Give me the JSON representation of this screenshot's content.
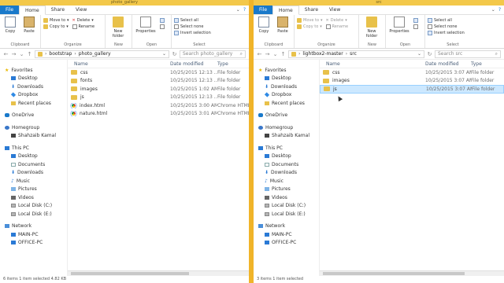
{
  "left": {
    "title": "photo_gallery",
    "tabs": [
      "File",
      "Home",
      "Share",
      "View"
    ],
    "ribbon": {
      "clipboard": {
        "copy": "Copy",
        "paste": "Paste",
        "group": "Clipboard"
      },
      "organize": {
        "move_to": "Move to",
        "copy_to": "Copy to",
        "delete": "Delete",
        "rename": "Rename",
        "group": "Organize"
      },
      "new": {
        "new_folder": "New folder",
        "group": "New"
      },
      "open": {
        "properties": "Properties",
        "group": "Open"
      },
      "select": {
        "select_all": "Select all",
        "select_none": "Select none",
        "invert": "Invert selection",
        "group": "Select"
      }
    },
    "address": [
      "bootstrap",
      "photo_gallery"
    ],
    "search_placeholder": "Search photo_gallery",
    "columns": {
      "name": "Name",
      "date": "Date modified",
      "type": "Type"
    },
    "files": [
      {
        "name": "css",
        "date": "10/25/2015 12:13 ...",
        "type": "File folder",
        "icon": "folder-icon"
      },
      {
        "name": "fonts",
        "date": "10/25/2015 12:13 ...",
        "type": "File folder",
        "icon": "folder-icon"
      },
      {
        "name": "images",
        "date": "10/25/2015 1:02 AM",
        "type": "File folder",
        "icon": "folder-icon"
      },
      {
        "name": "js",
        "date": "10/25/2015 12:13 ...",
        "type": "File folder",
        "icon": "folder-icon"
      },
      {
        "name": "index.html",
        "date": "10/25/2015 3:00 AM",
        "type": "Chrome HTML",
        "icon": "chrome-icon"
      },
      {
        "name": "nature.html",
        "date": "10/25/2015 3:01 AM",
        "type": "Chrome HTML",
        "icon": "chrome-icon"
      }
    ],
    "status": "6 items   1 item selected  4.82 KB"
  },
  "right": {
    "title": "src",
    "tabs": [
      "File",
      "Home",
      "Share",
      "View"
    ],
    "address": [
      "lightbox2-master",
      "src"
    ],
    "search_placeholder": "Search src",
    "columns": {
      "name": "Name",
      "date": "Date modified",
      "type": "Type"
    },
    "files": [
      {
        "name": "css",
        "date": "10/25/2015 3:07 AM",
        "type": "File folder",
        "icon": "folder-icon"
      },
      {
        "name": "images",
        "date": "10/25/2015 3:07 AM",
        "type": "File folder",
        "icon": "folder-icon"
      },
      {
        "name": "js",
        "date": "10/25/2015 3:07 AM",
        "type": "File folder",
        "icon": "folder-icon",
        "selected": true
      }
    ],
    "status": "3 items   1 item selected"
  },
  "nav": {
    "favorites": "Favorites",
    "desktop": "Desktop",
    "downloads": "Downloads",
    "dropbox": "Dropbox",
    "recent": "Recent places",
    "onedrive": "OneDrive",
    "homegroup": "Homegroup",
    "user": "Shahzaib Kamal",
    "thispc": "This PC",
    "documents": "Documents",
    "music": "Music",
    "pictures": "Pictures",
    "videos": "Videos",
    "localc": "Local Disk (C:)",
    "locale": "Local Disk (E:)",
    "network": "Network",
    "mainpc": "MAIN-PC",
    "officepc": "OFFICE-PC"
  },
  "colors": {
    "file_tab": "#1979ca",
    "selection": "#cce8ff",
    "titlebar": "#f3c84a",
    "desktop": "#f0b429"
  }
}
